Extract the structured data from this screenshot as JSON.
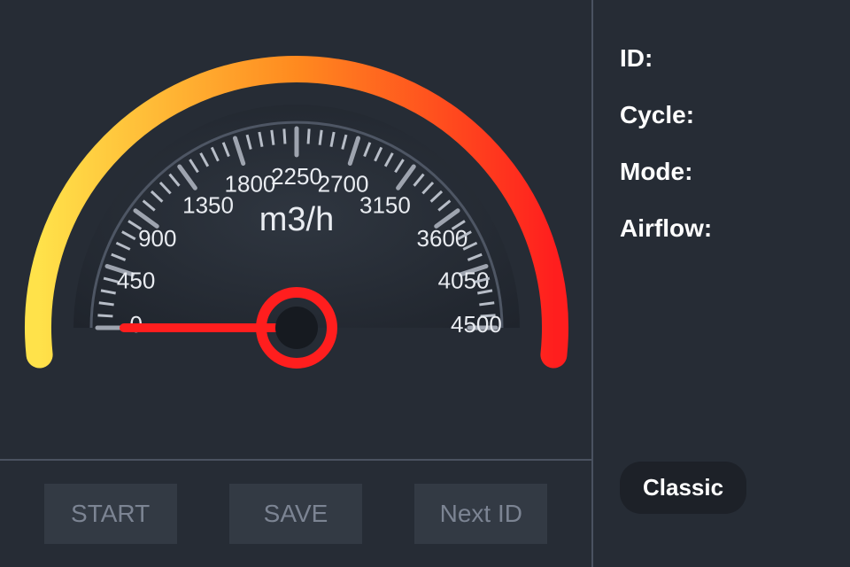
{
  "gauge": {
    "unit": "m3/h",
    "min": 0,
    "max": 4500,
    "ticks": [
      0,
      450,
      900,
      1350,
      1800,
      2250,
      2700,
      3150,
      3600,
      4050,
      4500
    ],
    "value": 0
  },
  "buttons": {
    "start": "START",
    "save": "SAVE",
    "next": "Next ID"
  },
  "info": {
    "id_label": "ID:",
    "id_value": "",
    "cycle_label": "Cycle:",
    "cycle_value": "",
    "mode_label": "Mode:",
    "mode_value": "",
    "airflow_label": "Airflow:",
    "airflow_value": ""
  },
  "toggle": {
    "label": "Classic"
  },
  "colors": {
    "arc_start": "#ffe24a",
    "arc_mid": "#ff8a1f",
    "arc_end": "#ff1e1e",
    "needle": "#ff1e1e",
    "tick": "#b7bdc7",
    "tick_major": "#9ea4af",
    "face_outer": "#2f3640",
    "face_inner": "#1f242c",
    "hub": "#161a20"
  }
}
